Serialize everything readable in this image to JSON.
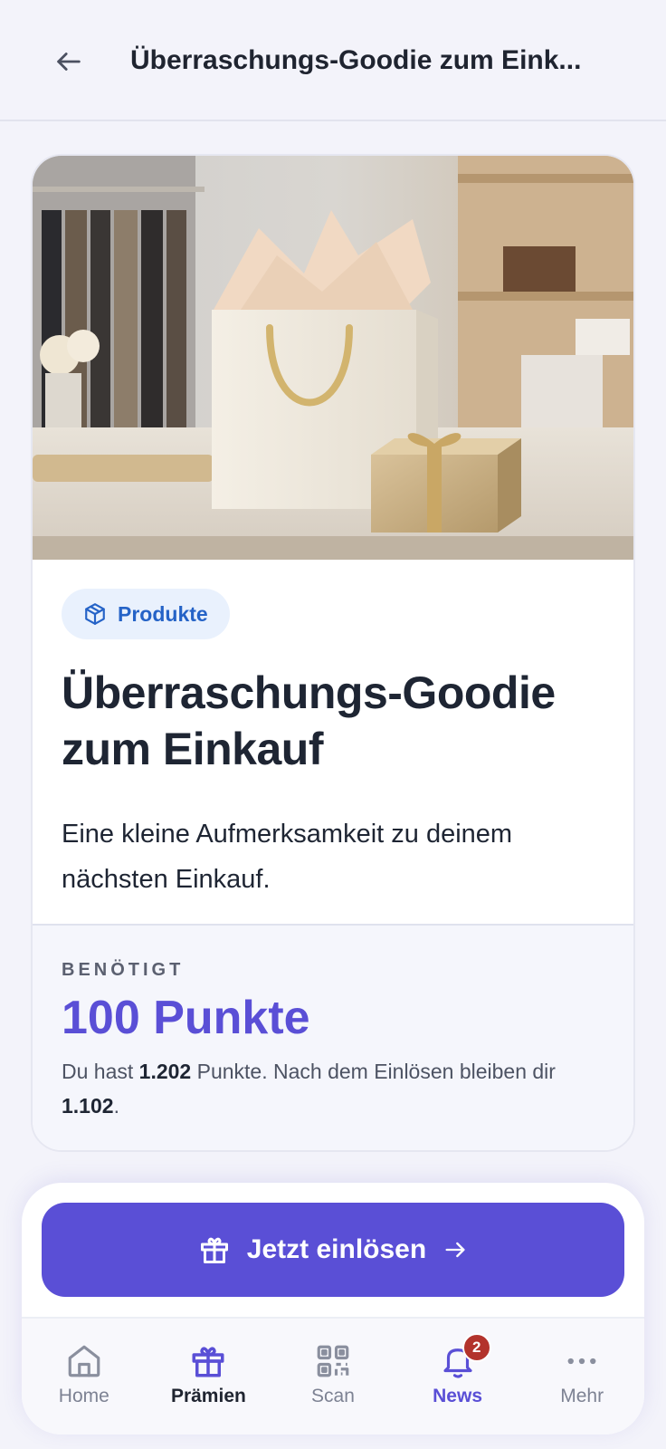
{
  "header": {
    "back_icon": "arrow-left-icon",
    "title": "Überraschungs-Goodie zum Eink..."
  },
  "reward": {
    "category": "Produkte",
    "category_icon": "package-icon",
    "title": "Überraschungs-Goodie zum Einkauf",
    "description": "Eine kleine Aufmerksamkeit zu deinem nächsten Einkauf.",
    "points_label": "BENÖTIGT",
    "points_value": "100 Punkte",
    "note_prefix": "Du hast ",
    "current_points": "1.202",
    "note_middle": " Punkte. Nach dem Einlösen bleiben dir ",
    "remaining_points": "1.102",
    "note_suffix": "."
  },
  "cta": {
    "label": "Jetzt einlösen",
    "icon": "gift-icon",
    "trailing_icon": "arrow-right-icon"
  },
  "nav": {
    "items": [
      {
        "label": "Home",
        "icon": "home-icon"
      },
      {
        "label": "Prämien",
        "icon": "gift-icon",
        "active": true
      },
      {
        "label": "Scan",
        "icon": "qr-code-icon"
      },
      {
        "label": "News",
        "icon": "bell-icon",
        "badge": "2"
      },
      {
        "label": "Mehr",
        "icon": "more-icon"
      }
    ]
  },
  "colors": {
    "accent": "#5a4fd6",
    "chip_bg": "#e9f1fd",
    "chip_text": "#2563c7",
    "badge": "#b3332c",
    "background": "#f3f3fa"
  }
}
